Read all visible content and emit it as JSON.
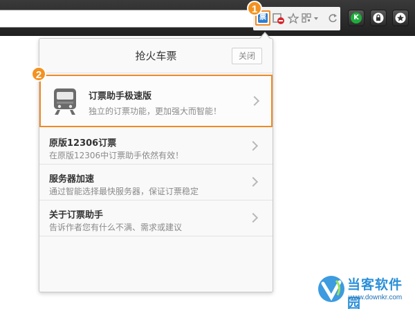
{
  "toolbar": {
    "ticket_ext_glyph": "票",
    "extension_buttons": [
      {
        "glyph": "K",
        "color": "#1fae3c"
      },
      {
        "glyph": "🔒",
        "color": "#ffffff"
      },
      {
        "glyph": "★",
        "color": "#ffffff"
      }
    ]
  },
  "markers": [
    "1",
    "2"
  ],
  "popup": {
    "title": "抢火车票",
    "close_label": "关闭",
    "featured": {
      "title": "订票助手极速版",
      "subtitle": "独立的订票功能，更加强大而智能！"
    },
    "items": [
      {
        "title": "原版12306订票",
        "subtitle": "在原版12306中订票助手依然有效！"
      },
      {
        "title": "服务器加速",
        "subtitle": "通过智能选择最快服务器，保证订票稳定"
      },
      {
        "title": "关于订票助手",
        "subtitle": "告诉作者您有什么不满、需求或建议"
      }
    ]
  },
  "watermark": {
    "name": "当客软件园",
    "url": "www.downkr.com"
  },
  "colors": {
    "accent": "#f08a24",
    "marker": "#f39221",
    "ticket_icon": "#2f7fd3"
  }
}
